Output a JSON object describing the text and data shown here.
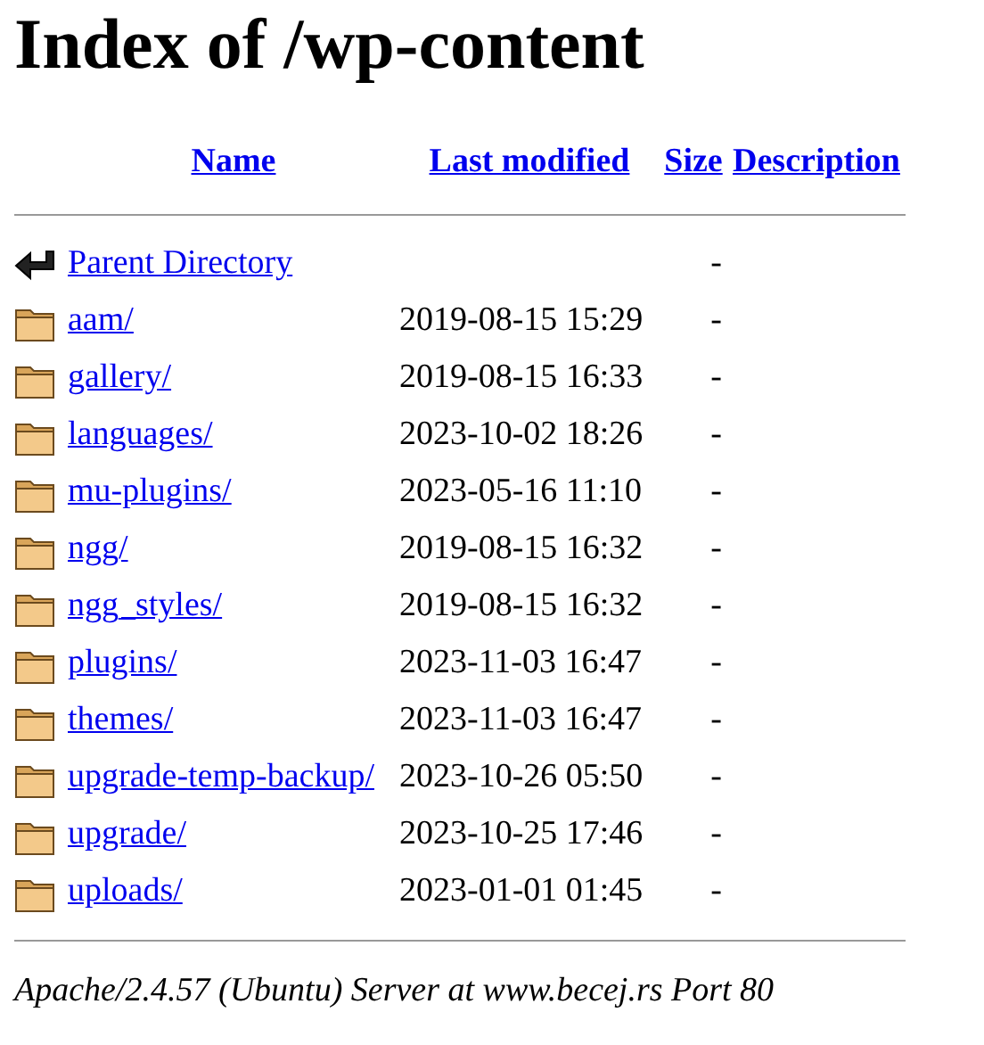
{
  "title": "Index of /wp-content",
  "columns": [
    "Name",
    "Last modified",
    "Size",
    "Description"
  ],
  "rows": [
    {
      "kind": "parent",
      "name": "Parent Directory",
      "modified": "",
      "size": "-"
    },
    {
      "kind": "folder",
      "name": "aam/",
      "modified": "2019-08-15 15:29",
      "size": "-"
    },
    {
      "kind": "folder",
      "name": "gallery/",
      "modified": "2019-08-15 16:33",
      "size": "-"
    },
    {
      "kind": "folder",
      "name": "languages/",
      "modified": "2023-10-02 18:26",
      "size": "-"
    },
    {
      "kind": "folder",
      "name": "mu-plugins/",
      "modified": "2023-05-16 11:10",
      "size": "-"
    },
    {
      "kind": "folder",
      "name": "ngg/",
      "modified": "2019-08-15 16:32",
      "size": "-"
    },
    {
      "kind": "folder",
      "name": "ngg_styles/",
      "modified": "2019-08-15 16:32",
      "size": "-"
    },
    {
      "kind": "folder",
      "name": "plugins/",
      "modified": "2023-11-03 16:47",
      "size": "-"
    },
    {
      "kind": "folder",
      "name": "themes/",
      "modified": "2023-11-03 16:47",
      "size": "-"
    },
    {
      "kind": "folder",
      "name": "upgrade-temp-backup/",
      "modified": "2023-10-26 05:50",
      "size": "-"
    },
    {
      "kind": "folder",
      "name": "upgrade/",
      "modified": "2023-10-25 17:46",
      "size": "-"
    },
    {
      "kind": "folder",
      "name": "uploads/",
      "modified": "2023-01-01 01:45",
      "size": "-"
    }
  ],
  "footer": "Apache/2.4.57 (Ubuntu) Server at www.becej.rs Port 80"
}
